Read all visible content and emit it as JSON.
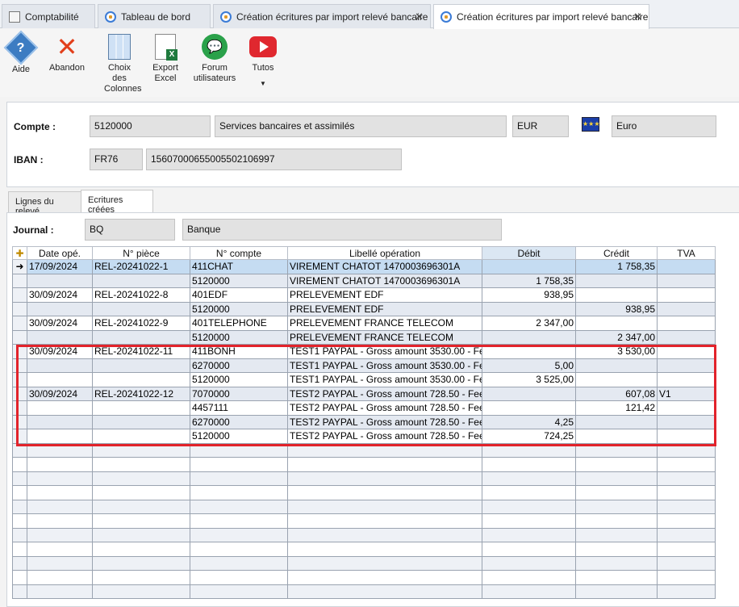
{
  "tabs": [
    {
      "label": "Comptabilité",
      "icon": "document-icon"
    },
    {
      "label": "Tableau de bord",
      "icon": "dashboard-icon"
    },
    {
      "label": "Création écritures par import relevé bancaire",
      "icon": "import-icon"
    },
    {
      "label": "Création écritures par import relevé bancaire",
      "icon": "import-icon",
      "active": true
    }
  ],
  "toolbar": {
    "help": "Aide",
    "cancel": "Abandon",
    "columns": "Choix des Colonnes",
    "export": "Export Excel",
    "forum": "Forum utilisateurs",
    "tutos": "Tutos"
  },
  "account": {
    "compte_label": "Compte :",
    "compte_number": "5120000",
    "compte_name": "Services bancaires et assimilés",
    "currency_code": "EUR",
    "currency_name": "Euro",
    "iban_label": "IBAN :",
    "iban_prefix": "FR76",
    "iban_rest": "15607000655005502106997"
  },
  "subtabs": [
    "Lignes du relevé",
    "Ecritures créées"
  ],
  "journal": {
    "label": "Journal :",
    "code": "BQ",
    "name": "Banque"
  },
  "grid": {
    "columns": [
      "Date opé.",
      "N° pièce",
      "N° compte",
      "Libellé opération",
      "Débit",
      "Crédit",
      "TVA"
    ],
    "rows": [
      [
        "17/09/2024",
        "REL-20241022-1",
        "411CHAT",
        "VIREMENT CHATOT 1470003696301A",
        "",
        "1 758,35",
        ""
      ],
      [
        "",
        "",
        "5120000",
        "VIREMENT CHATOT 1470003696301A",
        "1 758,35",
        "",
        ""
      ],
      [
        "30/09/2024",
        "REL-20241022-8",
        "401EDF",
        "PRELEVEMENT EDF",
        "938,95",
        "",
        ""
      ],
      [
        "",
        "",
        "5120000",
        "PRELEVEMENT EDF",
        "",
        "938,95",
        ""
      ],
      [
        "30/09/2024",
        "REL-20241022-9",
        "401TELEPHONE",
        "PRELEVEMENT FRANCE TELECOM",
        "2 347,00",
        "",
        ""
      ],
      [
        "",
        "",
        "5120000",
        "PRELEVEMENT FRANCE TELECOM",
        "",
        "2 347,00",
        ""
      ],
      [
        "30/09/2024",
        "REL-20241022-11",
        "411BONH",
        "TEST1 PAYPAL - Gross amount 3530.00 - Fe",
        "",
        "3 530,00",
        ""
      ],
      [
        "",
        "",
        "6270000",
        "TEST1 PAYPAL - Gross amount 3530.00 - Fe",
        "5,00",
        "",
        ""
      ],
      [
        "",
        "",
        "5120000",
        "TEST1 PAYPAL - Gross amount 3530.00 - Fe",
        "3 525,00",
        "",
        ""
      ],
      [
        "30/09/2024",
        "REL-20241022-12",
        "7070000",
        "TEST2 PAYPAL - Gross amount 728.50 - Fee",
        "",
        "607,08",
        "V1"
      ],
      [
        "",
        "",
        "4457111",
        "TEST2 PAYPAL - Gross amount 728.50 - Fee",
        "",
        "121,42",
        ""
      ],
      [
        "",
        "",
        "6270000",
        "TEST2 PAYPAL - Gross amount 728.50 - Fee",
        "4,25",
        "",
        ""
      ],
      [
        "",
        "",
        "5120000",
        "TEST2 PAYPAL - Gross amount 728.50 - Fee",
        "724,25",
        "",
        ""
      ]
    ]
  },
  "colors": {
    "selected_row": "#c5dcf2",
    "highlight_box": "#e2232b"
  }
}
